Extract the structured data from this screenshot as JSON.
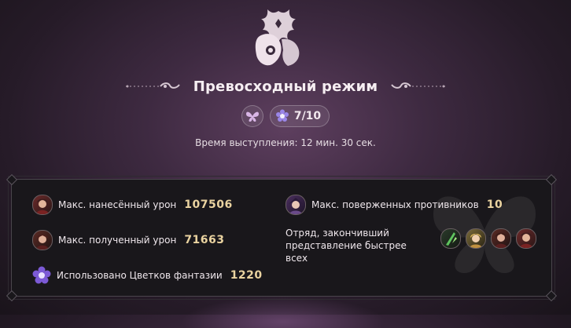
{
  "header": {
    "emblem_icon": "flower-crest-emblem-icon",
    "title": "Превосходный режим",
    "badge_icon": "butterfly-badge-icon",
    "score_icon": "star-flower-icon",
    "score": "7/10",
    "time_text": "Время выступления: 12 мин. 30 сек."
  },
  "stats": {
    "max_damage_dealt": {
      "label": "Макс. нанесённый урон",
      "value": "107506",
      "icon": "character-avatar-icon"
    },
    "max_enemies_defeated": {
      "label": "Макс. поверженных противников",
      "value": "10",
      "icon": "character-avatar-icon"
    },
    "max_damage_taken": {
      "label": "Макс. полученный урон",
      "value": "71663",
      "icon": "character-avatar-icon"
    },
    "fastest_team": {
      "label": "Отряд, закончивший представление быстрее всех",
      "line1": "Отряд, закончивший",
      "line2": "представление быстрее всех",
      "members": 4
    },
    "fantasy_flowers": {
      "label": "Использовано Цветков фантазии",
      "value": "1220",
      "icon": "fantasy-flower-icon"
    }
  },
  "colors": {
    "value_gold": "#ead3a0",
    "panel_bg": "#19171b",
    "accent_purple": "#8a6cc9"
  }
}
